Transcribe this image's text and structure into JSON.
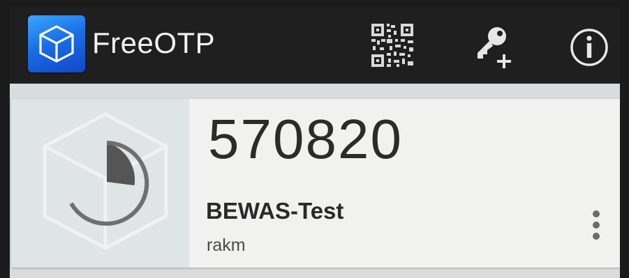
{
  "action_bar": {
    "app_title": "FreeOTP",
    "app_icon": "freeotp-cube-logo-icon",
    "actions": [
      {
        "name": "scan-qr-code",
        "icon": "qr-code-icon"
      },
      {
        "name": "add-token",
        "icon": "key-plus-icon"
      },
      {
        "name": "about",
        "icon": "info-circle-icon"
      }
    ]
  },
  "tokens": [
    {
      "code": "570820",
      "issuer": "BEWAS-Test",
      "label": "rakm",
      "timer_icon": "countdown-progress-icon",
      "timer_remaining_fraction": 0.62,
      "menu_icon": "more-vert-icon"
    }
  ],
  "colors": {
    "action_bar_bg": "#1f1f1f",
    "logo_blue": "#1b6fe6",
    "card_bg": "#f1f1f0",
    "image_bg": "#dfe4e5",
    "code_text": "#2b2b2b"
  }
}
